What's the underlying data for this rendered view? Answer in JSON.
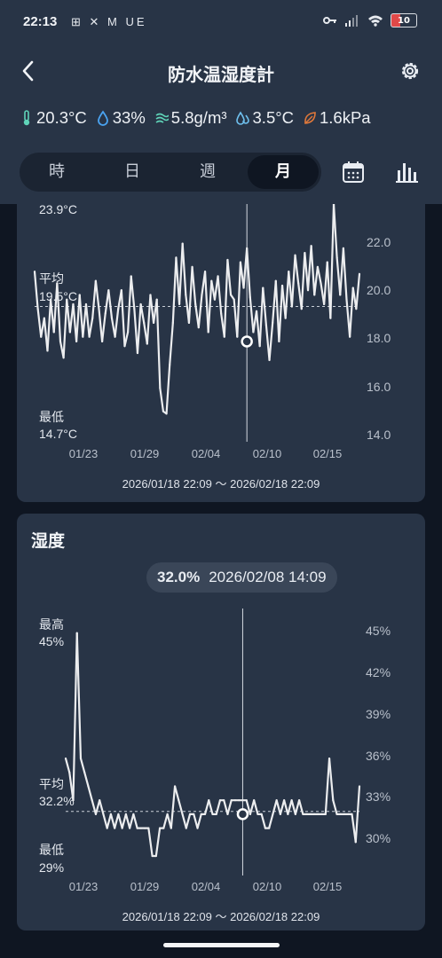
{
  "status_bar": {
    "time": "22:13",
    "left_icons": "⊞ ✕ M UE",
    "battery": "10",
    "icons": [
      "grid-icon",
      "hammer-icon",
      "gmail-icon",
      "ue-text",
      "key-icon",
      "signal-icon",
      "wifi-icon",
      "battery-icon"
    ]
  },
  "header": {
    "title": "防水温湿度計",
    "metrics": [
      {
        "icon": "thermometer-icon",
        "value": "20.3°C",
        "color": "#5fd3b8"
      },
      {
        "icon": "droplet-icon",
        "value": "33%",
        "color": "#4aa3f0"
      },
      {
        "icon": "absolute-humidity-icon",
        "value": "5.8g/m³",
        "color": "#5fd3b8"
      },
      {
        "icon": "dewpoint-icon",
        "value": "3.5°C",
        "color": "#6fc0ee"
      },
      {
        "icon": "leaf-icon",
        "value": "1.6kPa",
        "color": "#e0783a"
      }
    ],
    "tabs": [
      "時",
      "日",
      "週",
      "月"
    ],
    "active_tab": "月"
  },
  "temp_card": {
    "max_label": "23.9°C",
    "avg_label": "平均",
    "avg_value": "19.5°C",
    "min_label": "最低",
    "min_value": "14.7°C",
    "range": "2026/01/18 22:09 〜 2026/02/18 22:09"
  },
  "humidity_card": {
    "title": "湿度",
    "tooltip_value": "32.0%",
    "tooltip_time": "2026/02/08 14:09",
    "max_label": "最高",
    "max_value": "45%",
    "avg_label": "平均",
    "avg_value": "32.2%",
    "min_label": "最低",
    "min_value": "29%",
    "range": "2026/01/18 22:09 〜 2026/02/18 22:09"
  },
  "chart_data": [
    {
      "type": "line",
      "title": "",
      "x_ticks": [
        "01/23",
        "01/29",
        "02/04",
        "02/10",
        "02/15"
      ],
      "y_ticks": [
        "22.0",
        "20.0",
        "18.0",
        "16.0",
        "14.0"
      ],
      "ylim": [
        14.0,
        23.9
      ],
      "average": 19.5,
      "selected_value": 18.0,
      "values": [
        21.0,
        19.4,
        18.2,
        19.0,
        17.6,
        19.8,
        18.4,
        20.5,
        18.0,
        17.3,
        19.8,
        18.4,
        19.6,
        18.0,
        20.0,
        18.2,
        19.6,
        18.2,
        19.0,
        20.6,
        19.4,
        18.0,
        19.2,
        20.2,
        19.0,
        18.2,
        19.4,
        20.2,
        17.8,
        18.4,
        20.8,
        19.4,
        17.5,
        19.6,
        18.8,
        17.9,
        20.0,
        18.8,
        19.8,
        16.0,
        15.0,
        14.9,
        17.0,
        18.8,
        21.6,
        19.6,
        22.2,
        20.0,
        18.8,
        21.2,
        19.6,
        18.6,
        20.0,
        21.0,
        18.4,
        20.6,
        19.8,
        20.8,
        19.2,
        18.2,
        21.5,
        20.0,
        19.8,
        18.2,
        21.4,
        20.3,
        22.0,
        19.9,
        18.4,
        19.3,
        17.8,
        20.3,
        18.7,
        17.2,
        18.8,
        20.6,
        18.0,
        20.4,
        19.0,
        21.0,
        19.5,
        21.7,
        20.5,
        19.4,
        21.8,
        20.2,
        22.1,
        20.0,
        21.2,
        20.5,
        19.6,
        21.4,
        19.0,
        23.9,
        21.6,
        20.0,
        22.0,
        19.8,
        18.2,
        20.3,
        19.4,
        20.9
      ]
    },
    {
      "type": "line",
      "title": "湿度",
      "x_ticks": [
        "01/23",
        "01/29",
        "02/04",
        "02/10",
        "02/15"
      ],
      "y_ticks": [
        "45%",
        "42%",
        "39%",
        "36%",
        "33%",
        "30%"
      ],
      "ylim": [
        29,
        46
      ],
      "average": 32.2,
      "selected_value": 32.0,
      "values": [
        36,
        35,
        33,
        45,
        36,
        35,
        34,
        33,
        32,
        33,
        32,
        31,
        32,
        31,
        32,
        31,
        32,
        31,
        32,
        31,
        31,
        31,
        31,
        29,
        29,
        31,
        31,
        32,
        31,
        34,
        33,
        32,
        31,
        32,
        32,
        31,
        32,
        32,
        33,
        32,
        32,
        33,
        33,
        32,
        33,
        33,
        33,
        33,
        33,
        32,
        33,
        32,
        32,
        31,
        31,
        32,
        33,
        32,
        33,
        32,
        33,
        32,
        33,
        32,
        32,
        32,
        32,
        32,
        32,
        32,
        36,
        33,
        32,
        32,
        32,
        32,
        32,
        30,
        34
      ]
    }
  ]
}
